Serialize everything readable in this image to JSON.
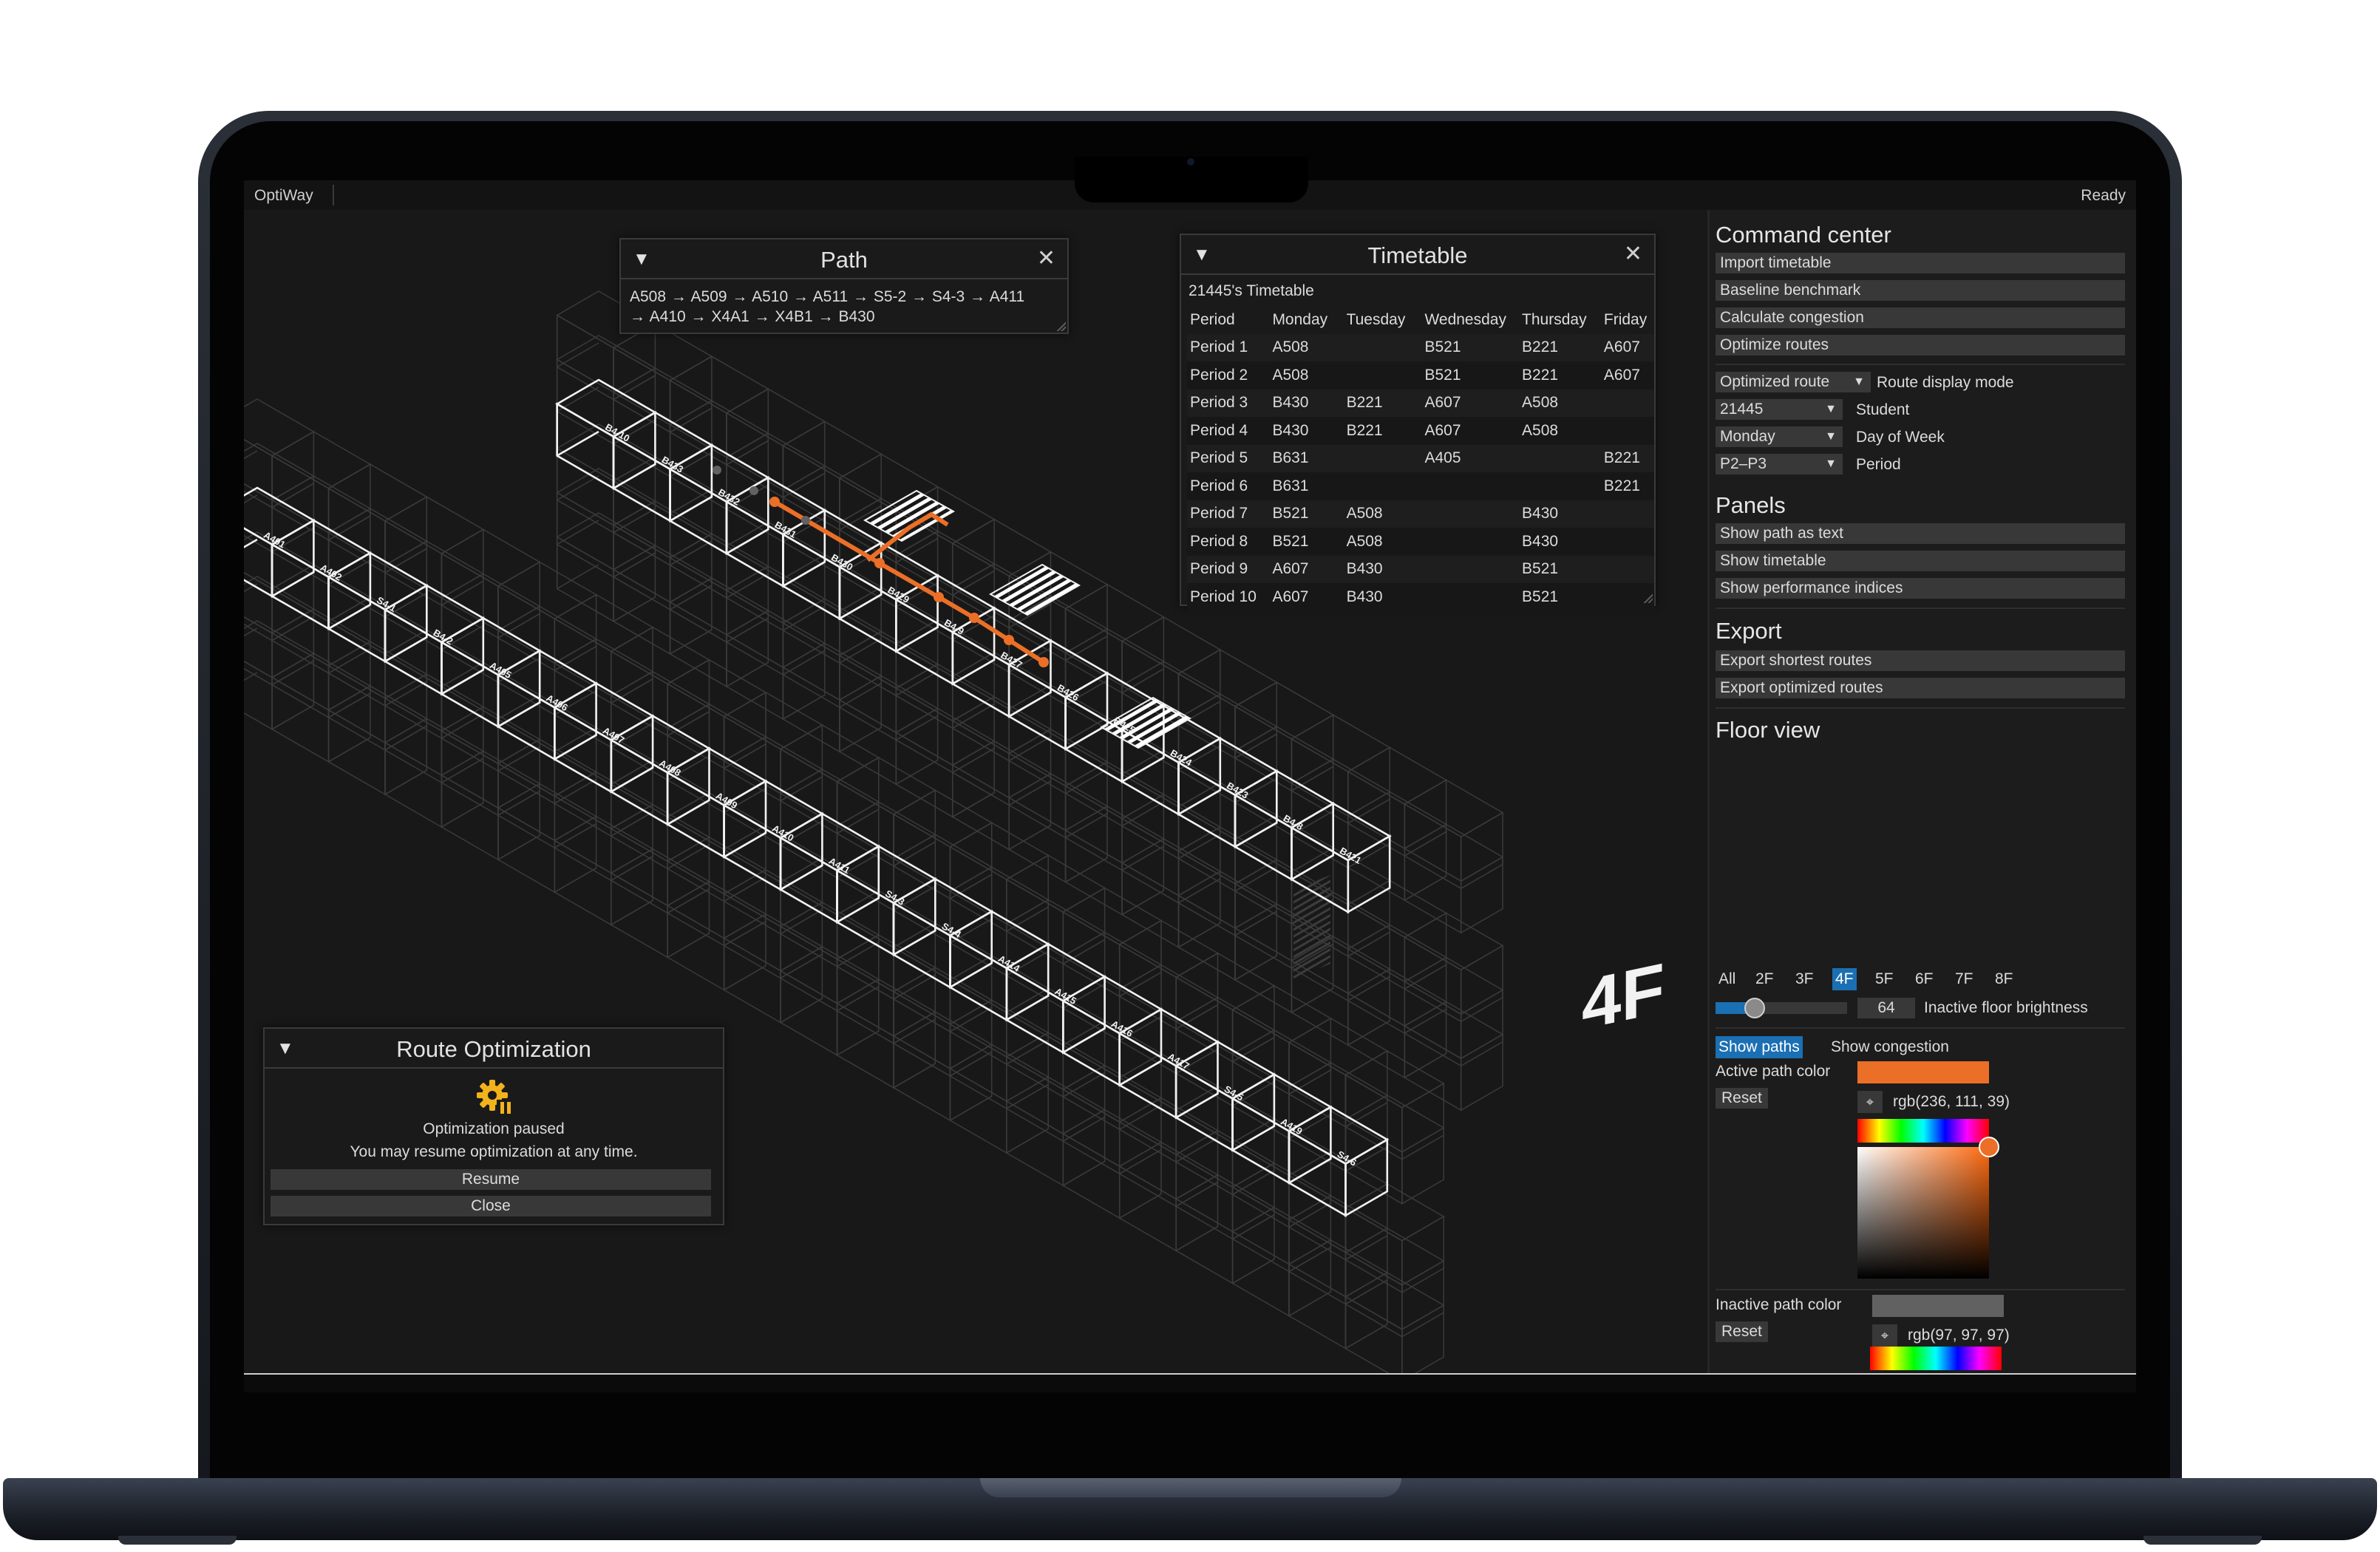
{
  "app": {
    "title": "OptiWay",
    "status": "Ready"
  },
  "path_panel": {
    "title": "Path",
    "line1": "A508 → A509 → A510 → A511 → S5-2 → S4-3 → A411",
    "line2": "→ A410 → X4A1 → X4B1 → B430"
  },
  "timetable": {
    "title": "Timetable",
    "caption": "21445's Timetable",
    "columns": [
      "Period",
      "Monday",
      "Tuesday",
      "Wednesday",
      "Thursday",
      "Friday"
    ],
    "rows": [
      [
        "Period 1",
        "A508",
        "",
        "B521",
        "B221",
        "A607"
      ],
      [
        "Period 2",
        "A508",
        "",
        "B521",
        "B221",
        "A607"
      ],
      [
        "Period 3",
        "B430",
        "B221",
        "A607",
        "A508",
        ""
      ],
      [
        "Period 4",
        "B430",
        "B221",
        "A607",
        "A508",
        ""
      ],
      [
        "Period 5",
        "B631",
        "",
        "A405",
        "",
        "B221"
      ],
      [
        "Period 6",
        "B631",
        "",
        "",
        "",
        "B221"
      ],
      [
        "Period 7",
        "B521",
        "A508",
        "",
        "B430",
        ""
      ],
      [
        "Period 8",
        "B521",
        "A508",
        "",
        "B430",
        ""
      ],
      [
        "Period 9",
        "A607",
        "B430",
        "",
        "B521",
        ""
      ],
      [
        "Period 10",
        "A607",
        "B430",
        "",
        "B521",
        ""
      ]
    ]
  },
  "route_opt": {
    "title": "Route Optimization",
    "status": "Optimization paused",
    "message": "You may resume optimization at any time.",
    "resume": "Resume",
    "close": "Close",
    "icon": "gear-pause-icon"
  },
  "command_center": {
    "title": "Command center",
    "buttons": [
      "Import timetable",
      "Baseline benchmark",
      "Calculate congestion",
      "Optimize routes"
    ],
    "route_mode": {
      "value": "Optimized route",
      "label": "Route display mode"
    },
    "student": {
      "value": "21445",
      "label": "Student"
    },
    "day": {
      "value": "Monday",
      "label": "Day of Week"
    },
    "period": {
      "value": "P2–P3",
      "label": "Period"
    }
  },
  "panels": {
    "title": "Panels",
    "buttons": [
      "Show path as text",
      "Show timetable",
      "Show performance indices"
    ]
  },
  "export": {
    "title": "Export",
    "buttons": [
      "Export shortest routes",
      "Export optimized routes"
    ]
  },
  "floor_view": {
    "title": "Floor view",
    "tabs": [
      "All",
      "2F",
      "3F",
      "4F",
      "5F",
      "6F",
      "7F",
      "8F"
    ],
    "active_tab": "4F",
    "brightness_value": "64",
    "brightness_label": "Inactive floor brightness",
    "brightness_fraction": 0.25
  },
  "display": {
    "show_paths": "Show paths",
    "show_congestion": "Show congestion",
    "active_color_label": "Active path color",
    "active_color_value": "rgb(236, 111, 39)",
    "active_color": "#ec6f27",
    "inactive_color_label": "Inactive path color",
    "inactive_color_value": "rgb(97, 97, 97)",
    "inactive_color": "#616161",
    "reset": "Reset"
  },
  "map": {
    "floor_label": "4F",
    "rooms": [
      "A401",
      "A402",
      "S4-1",
      "B4-2",
      "A405",
      "A406",
      "A407",
      "A408",
      "A409",
      "A410",
      "A411",
      "S4-3",
      "S4-4",
      "A414",
      "A415",
      "A416",
      "A417",
      "S4-5",
      "A419",
      "S4-6",
      "B4-10",
      "B433",
      "B432",
      "B431",
      "B430",
      "B429",
      "B4-9",
      "B427",
      "B426",
      "B425",
      "B424",
      "B423",
      "B4-8",
      "B421"
    ],
    "accent": "#ec6f27"
  }
}
